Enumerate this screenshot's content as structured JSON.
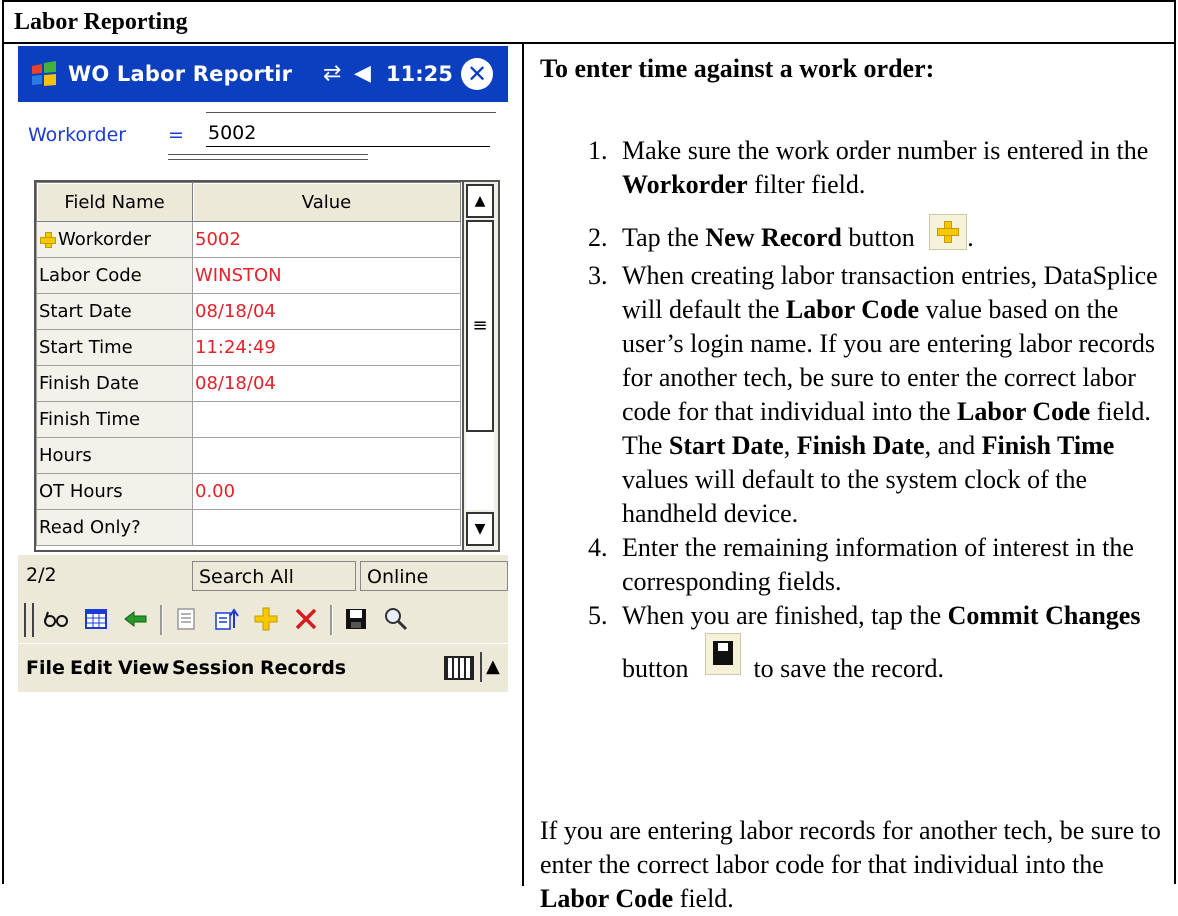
{
  "section": {
    "title": "Labor Reporting"
  },
  "device": {
    "titlebar": {
      "title": "WO Labor Reportir",
      "time": "11:25",
      "connectivity_icon": "sync-arrows-icon",
      "volume_icon": "speaker-icon",
      "close_icon": "close-icon",
      "start_icon": "windows-logo-icon"
    },
    "filter": {
      "label": "Workorder",
      "operator": "=",
      "value": "5002"
    },
    "grid": {
      "columns": [
        "Field Name",
        "Value"
      ],
      "rows": [
        {
          "field": "Workorder",
          "value": "5002",
          "new_record_marker": true
        },
        {
          "field": "Labor Code",
          "value": "WINSTON"
        },
        {
          "field": "Start Date",
          "value": "08/18/04"
        },
        {
          "field": "Start Time",
          "value": "11:24:49"
        },
        {
          "field": "Finish Date",
          "value": "08/18/04"
        },
        {
          "field": "Finish Time",
          "value": ""
        },
        {
          "field": "Hours",
          "value": ""
        },
        {
          "field": "OT Hours",
          "value": "0.00"
        },
        {
          "field": "Read Only?",
          "value": ""
        }
      ],
      "value_color": "#e4222a"
    },
    "status": {
      "count": "2/2",
      "search": "Search All",
      "mode": "Online"
    },
    "toolbar": [
      "glasses-icon",
      "calendar-icon",
      "back-arrow-icon",
      "list-icon",
      "upload-icon",
      "new-record-icon",
      "delete-icon",
      "save-icon",
      "search-icon"
    ],
    "menu": {
      "file": "File",
      "edit": "Edit",
      "view": "View",
      "session": "Session",
      "records": "Records"
    },
    "colors": {
      "titlebar": "#0b3fbf",
      "chrome": "#ece9d8",
      "filter_label": "#1b3bd6"
    }
  },
  "instructions": {
    "heading": "To enter time against a work order:",
    "step1": {
      "a": "Make sure the work order number is entered in the ",
      "b": "Workorder",
      "c": " filter field."
    },
    "step2": {
      "a": "Tap the ",
      "b": "New Record",
      "c": " button ",
      "d": "."
    },
    "step3": {
      "a": "When creating labor transaction entries, DataSplice will default the ",
      "b": "Labor Code",
      "c": " value based on the user’s login name.  If you are entering labor records for another tech, be sure to enter the correct labor code for that individual into the ",
      "d": "Labor Code",
      "e": " field.  The ",
      "f": "Start Date",
      "g": ", ",
      "h": "Finish Date",
      "i": ", and ",
      "j": "Finish Time",
      "k": " values will default to the system clock of the handheld device."
    },
    "step4": "Enter the remaining information of interest in the corresponding fields.",
    "step5": {
      "a": "When you are finished, tap the ",
      "b": "Commit Changes",
      "c": " button ",
      "d": " to save the record."
    },
    "footer": {
      "a": "If you are entering labor records for another tech, be sure to enter the correct labor code for that individual into the ",
      "b": "Labor Code",
      "c": " field."
    }
  }
}
